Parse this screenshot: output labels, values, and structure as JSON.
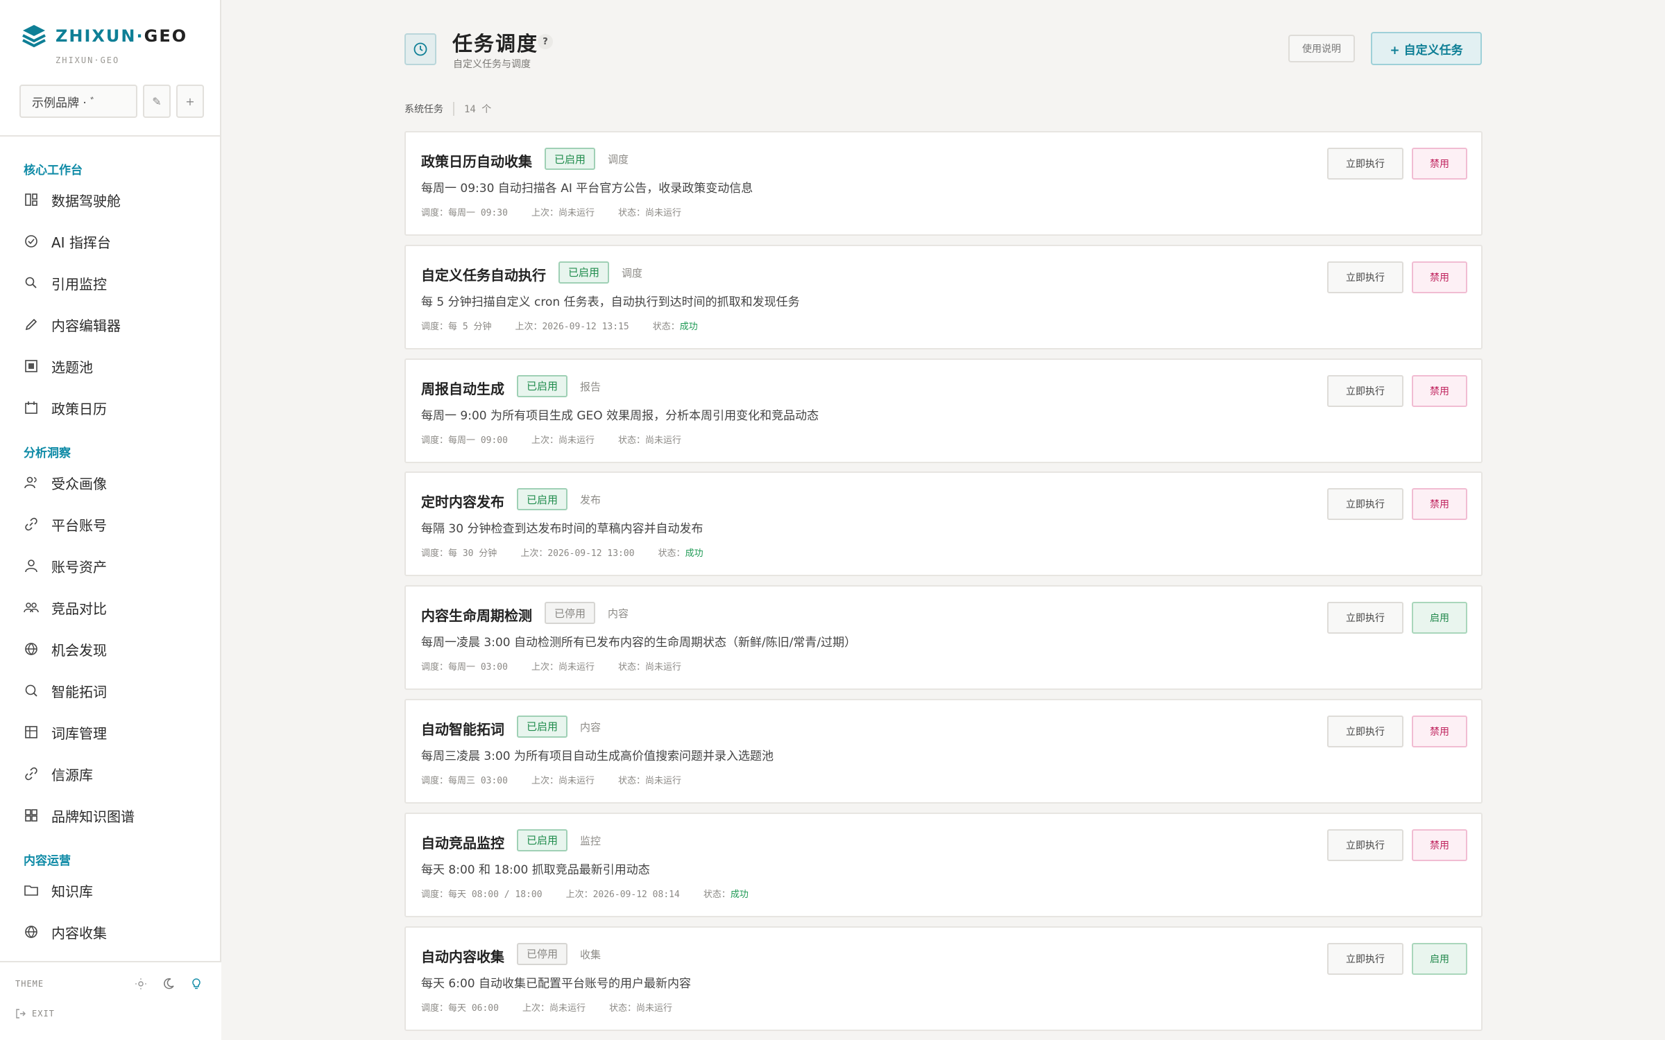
{
  "sidebar": {
    "logo_main": "ZHIXUN",
    "logo_dot": "·",
    "logo_geo": "GEO",
    "logo_sub": "ZHIXUN·GEO",
    "brand_select": "示例品牌 · ﾞ",
    "brand_edit_icon": "✎",
    "brand_add": "+",
    "sections": [
      {
        "title": "核心工作台",
        "items": [
          {
            "label": "数据驾驶舱",
            "icon": "dashboard-icon"
          },
          {
            "label": "AI 指挥台",
            "icon": "check-circle-icon"
          },
          {
            "label": "引用监控",
            "icon": "search-icon"
          },
          {
            "label": "内容编辑器",
            "icon": "pencil-icon"
          },
          {
            "label": "选题池",
            "icon": "square-list-icon"
          },
          {
            "label": "政策日历",
            "icon": "calendar-icon"
          }
        ]
      },
      {
        "title": "分析洞察",
        "items": [
          {
            "label": "受众画像",
            "icon": "users-icon"
          },
          {
            "label": "平台账号",
            "icon": "link-icon"
          },
          {
            "label": "账号资产",
            "icon": "user-icon"
          },
          {
            "label": "竞品对比",
            "icon": "group-icon"
          },
          {
            "label": "机会发现",
            "icon": "globe-icon"
          },
          {
            "label": "智能拓词",
            "icon": "magnifier-icon"
          },
          {
            "label": "词库管理",
            "icon": "table-icon"
          },
          {
            "label": "信源库",
            "icon": "link-icon"
          },
          {
            "label": "品牌知识图谱",
            "icon": "grid-icon"
          }
        ]
      },
      {
        "title": "内容运营",
        "items": [
          {
            "label": "知识库",
            "icon": "folder-icon"
          },
          {
            "label": "内容收集",
            "icon": "globe-icon"
          }
        ]
      }
    ],
    "theme_label": "THEME",
    "exit_label": "EXIT"
  },
  "header": {
    "title": "任务调度",
    "help": "?",
    "subtitle": "自定义任务与调度",
    "usage_button": "使用说明",
    "custom_button": "+ 自定义任务"
  },
  "section": {
    "label": "系统任务",
    "count": "14 个"
  },
  "labels": {
    "run": "立即执行",
    "disable": "禁用",
    "enable": "启用"
  },
  "tasks": [
    {
      "name": "政策日历自动收集",
      "state": "已启用",
      "enabled": true,
      "category": "调度",
      "desc": "每周一 09:30 自动扫描各 AI 平台官方公告，收录政策变动信息",
      "schedule": "调度：每周一 09:30",
      "last": "上次：尚未运行",
      "status_label": "状态：",
      "status": "尚未运行",
      "status_ok": false
    },
    {
      "name": "自定义任务自动执行",
      "state": "已启用",
      "enabled": true,
      "category": "调度",
      "desc": "每 5 分钟扫描自定义 cron 任务表，自动执行到达时间的抓取和发现任务",
      "schedule": "调度：每 5 分钟",
      "last": "上次：2026-09-12 13:15",
      "status_label": "状态：",
      "status": "成功",
      "status_ok": true
    },
    {
      "name": "周报自动生成",
      "state": "已启用",
      "enabled": true,
      "category": "报告",
      "desc": "每周一 9:00 为所有项目生成 GEO 效果周报，分析本周引用变化和竞品动态",
      "schedule": "调度：每周一 09:00",
      "last": "上次：尚未运行",
      "status_label": "状态：",
      "status": "尚未运行",
      "status_ok": false
    },
    {
      "name": "定时内容发布",
      "state": "已启用",
      "enabled": true,
      "category": "发布",
      "desc": "每隔 30 分钟检查到达发布时间的草稿内容并自动发布",
      "schedule": "调度：每 30 分钟",
      "last": "上次：2026-09-12 13:00",
      "status_label": "状态：",
      "status": "成功",
      "status_ok": true
    },
    {
      "name": "内容生命周期检测",
      "state": "已停用",
      "enabled": false,
      "category": "内容",
      "desc": "每周一凌晨 3:00 自动检测所有已发布内容的生命周期状态（新鲜/陈旧/常青/过期）",
      "schedule": "调度：每周一 03:00",
      "last": "上次：尚未运行",
      "status_label": "状态：",
      "status": "尚未运行",
      "status_ok": false
    },
    {
      "name": "自动智能拓词",
      "state": "已启用",
      "enabled": true,
      "category": "内容",
      "desc": "每周三凌晨 3:00 为所有项目自动生成高价值搜索问题并录入选题池",
      "schedule": "调度：每周三 03:00",
      "last": "上次：尚未运行",
      "status_label": "状态：",
      "status": "尚未运行",
      "status_ok": false
    },
    {
      "name": "自动竞品监控",
      "state": "已启用",
      "enabled": true,
      "category": "监控",
      "desc": "每天 8:00 和 18:00 抓取竞品最新引用动态",
      "schedule": "调度：每天 08:00 / 18:00",
      "last": "上次：2026-09-12 08:14",
      "status_label": "状态：",
      "status": "成功",
      "status_ok": true
    },
    {
      "name": "自动内容收集",
      "state": "已停用",
      "enabled": false,
      "category": "收集",
      "desc": "每天 6:00 自动收集已配置平台账号的用户最新内容",
      "schedule": "调度：每天 06:00",
      "last": "上次：尚未运行",
      "status_label": "状态：",
      "status": "尚未运行",
      "status_ok": false
    }
  ],
  "colors": {
    "accent": "#0e8aa6",
    "enabled_green": "#1f8c4c",
    "disable_pink": "#c0255f"
  }
}
